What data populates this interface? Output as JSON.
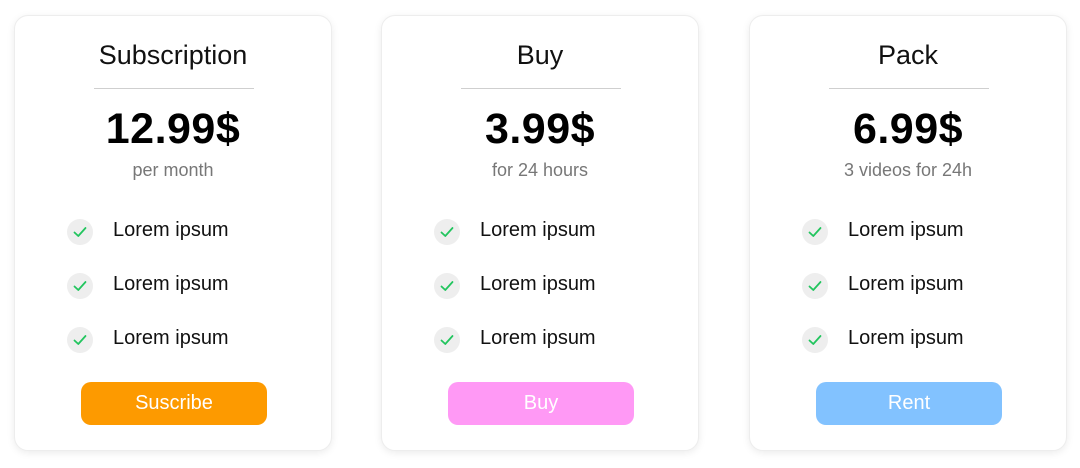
{
  "plans": [
    {
      "title": "Subscription",
      "price": "12.99$",
      "period": "per month",
      "features": [
        "Lorem ipsum",
        "Lorem ipsum",
        "Lorem ipsum"
      ],
      "button_label": "Suscribe",
      "button_color": "#fd9a00"
    },
    {
      "title": "Buy",
      "price": "3.99$",
      "period": "for 24 hours",
      "features": [
        "Lorem ipsum",
        "Lorem ipsum",
        "Lorem ipsum"
      ],
      "button_label": "Buy",
      "button_color": "#ff99f5"
    },
    {
      "title": "Pack",
      "price": "6.99$",
      "period": "3 videos for 24h",
      "features": [
        "Lorem ipsum",
        "Lorem ipsum",
        "Lorem ipsum"
      ],
      "button_label": "Rent",
      "button_color": "#82c2ff"
    }
  ],
  "icons": {
    "feature": "check-icon"
  },
  "colors": {
    "check": "#22c55e",
    "check_bg": "#eeeeee"
  }
}
